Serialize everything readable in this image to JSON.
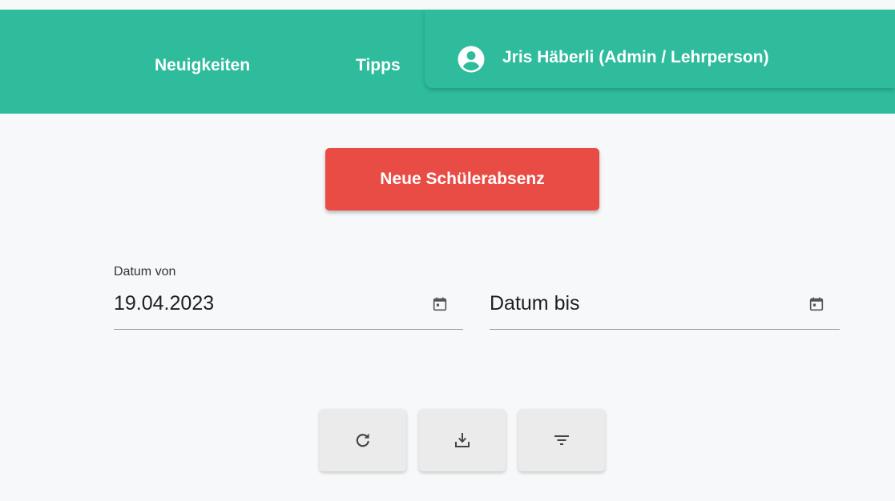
{
  "header": {
    "nav": [
      {
        "label": "Neuigkeiten"
      },
      {
        "label": "Tipps"
      }
    ],
    "user": {
      "name": "Jris Häberli (Admin / Lehrperson)",
      "icon": "account-circle-icon"
    }
  },
  "main": {
    "new_absence_label": "Neue Schülerabsenz",
    "date_from": {
      "label": "Datum von",
      "value": "19.04.2023",
      "icon": "calendar-icon"
    },
    "date_to": {
      "placeholder": "Datum bis",
      "icon": "calendar-icon"
    },
    "actions": [
      {
        "icon": "refresh-icon"
      },
      {
        "icon": "download-icon"
      },
      {
        "icon": "filter-icon"
      }
    ]
  },
  "colors": {
    "header_bg": "#2ebc9d",
    "primary_button": "#e84c44",
    "page_bg": "#f7f8fa",
    "icon_button_bg": "#ebebeb"
  }
}
